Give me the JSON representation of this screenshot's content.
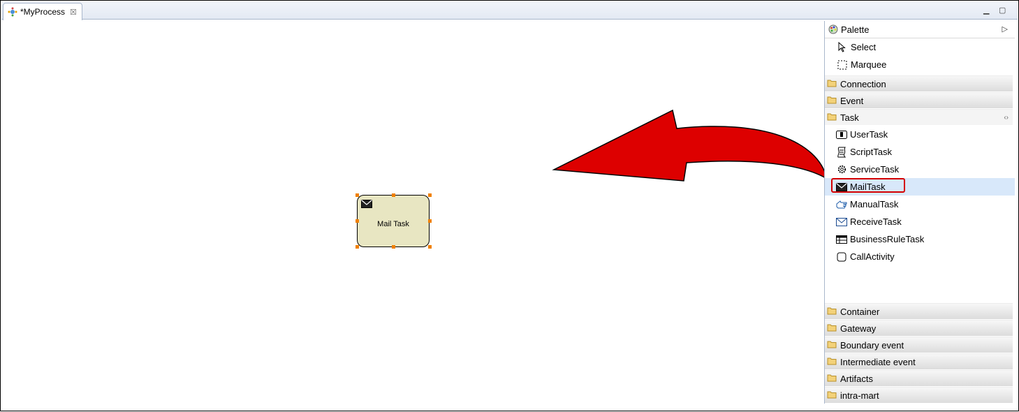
{
  "editor": {
    "tab_title": "*MyProcess",
    "tab_icon": "process-icon",
    "close_icon": "close-icon"
  },
  "canvas": {
    "task_node": {
      "label": "Mail Task",
      "icon": "envelope-icon",
      "fill_color": "#e8e6c2",
      "selection_handle_color": "#f08000"
    },
    "arrow_color": "#dd0000"
  },
  "palette": {
    "title": "Palette",
    "tools": [
      {
        "label": "Select",
        "icon": "cursor-arrow-icon"
      },
      {
        "label": "Marquee",
        "icon": "marquee-icon"
      }
    ],
    "drawers_top": [
      {
        "label": "Connection"
      },
      {
        "label": "Event"
      }
    ],
    "task_drawer": {
      "label": "Task",
      "items": [
        {
          "label": "UserTask",
          "icon": "user-task-icon"
        },
        {
          "label": "ScriptTask",
          "icon": "script-task-icon"
        },
        {
          "label": "ServiceTask",
          "icon": "gear-icon"
        },
        {
          "label": "MailTask",
          "icon": "envelope-icon",
          "selected": true
        },
        {
          "label": "ManualTask",
          "icon": "hand-icon"
        },
        {
          "label": "ReceiveTask",
          "icon": "envelope-outline-icon"
        },
        {
          "label": "BusinessRuleTask",
          "icon": "table-icon"
        },
        {
          "label": "CallActivity",
          "icon": "rounded-square-icon"
        }
      ]
    },
    "drawers_bottom": [
      {
        "label": "Container"
      },
      {
        "label": "Gateway"
      },
      {
        "label": "Boundary event"
      },
      {
        "label": "Intermediate event"
      },
      {
        "label": "Artifacts"
      },
      {
        "label": "intra-mart"
      }
    ],
    "highlight_color": "#d40000"
  }
}
